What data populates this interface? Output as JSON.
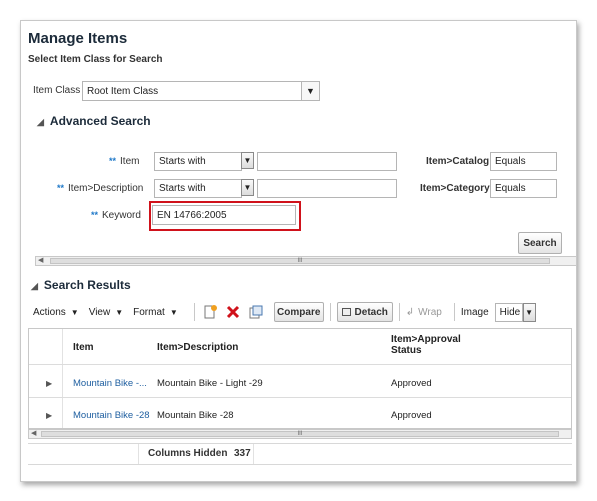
{
  "page": {
    "title": "Manage Items",
    "subtitle": "Select Item Class for Search"
  },
  "item_class": {
    "label": "Item Class",
    "value": "Root Item Class"
  },
  "advanced_search": {
    "title": "Advanced Search",
    "required_marker": "**",
    "rows": [
      {
        "label": "Item",
        "operator": "Starts with",
        "value": ""
      },
      {
        "label": "Item>Description",
        "operator": "Starts with",
        "value": ""
      }
    ],
    "keyword": {
      "label": "Keyword",
      "value": "EN 14766:2005"
    },
    "right_fields": [
      {
        "label": "Item>Catalog",
        "operator": "Equals"
      },
      {
        "label": "Item>Category",
        "operator": "Equals"
      }
    ],
    "search_button": "Search"
  },
  "results": {
    "title": "Search Results",
    "toolbar": {
      "actions": "Actions",
      "view": "View",
      "format": "Format",
      "compare": "Compare",
      "detach": "Detach",
      "wrap": "Wrap",
      "image_label": "Image",
      "image_value": "Hide"
    },
    "columns": [
      "Item",
      "Item>Description",
      "Item>Approval Status"
    ],
    "rows": [
      {
        "item": "Mountain Bike -...",
        "description": "Mountain Bike - Light -29",
        "status": "Approved"
      },
      {
        "item": "Mountain Bike -28",
        "description": "Mountain Bike -28",
        "status": "Approved"
      }
    ],
    "columns_hidden_label": "Columns Hidden",
    "columns_hidden_value": "337"
  },
  "colors": {
    "highlight": "#d0121b",
    "link": "#1f5fa0",
    "required_marker": "#1e78c8"
  }
}
